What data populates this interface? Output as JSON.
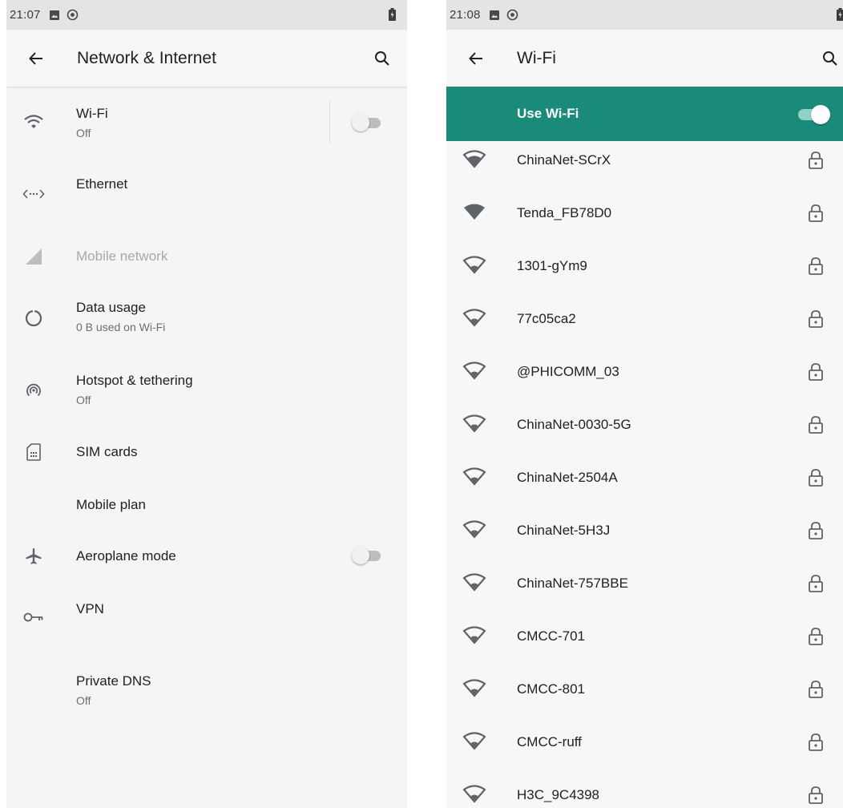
{
  "left": {
    "status": {
      "time": "21:07"
    },
    "title": "Network & Internet",
    "items": [
      {
        "title": "Wi-Fi",
        "subtitle": "Off",
        "icon": "wifi-icon"
      },
      {
        "title": "Ethernet",
        "subtitle": "",
        "icon": "ethernet-icon"
      },
      {
        "title": "Mobile network",
        "subtitle": "",
        "icon": "cellular-signal-icon"
      },
      {
        "title": "Data usage",
        "subtitle": "0 B used on Wi-Fi",
        "icon": "data-usage-icon"
      },
      {
        "title": "Hotspot & tethering",
        "subtitle": "Off",
        "icon": "hotspot-icon"
      },
      {
        "title": "SIM cards",
        "subtitle": "",
        "icon": "sim-card-icon"
      },
      {
        "title": "Mobile plan",
        "subtitle": ""
      },
      {
        "title": "Aeroplane mode",
        "subtitle": "",
        "icon": "airplane-icon"
      },
      {
        "title": "VPN",
        "subtitle": "",
        "icon": "vpn-key-icon"
      },
      {
        "title": "Private DNS",
        "subtitle": "Off"
      }
    ]
  },
  "right": {
    "status": {
      "time": "21:08"
    },
    "title": "Wi-Fi",
    "use_wifi_label": "Use Wi-Fi",
    "networks": [
      "ChinaNet-SCrX",
      "Tenda_FB78D0",
      "1301-gYm9",
      "77c05ca2",
      "@PHICOMM_03",
      "ChinaNet-0030-5G",
      "ChinaNet-2504A",
      "ChinaNet-5H3J",
      "ChinaNet-757BBE",
      "CMCC-701",
      "CMCC-801",
      "CMCC-ruff",
      "H3C_9C4398"
    ]
  },
  "colors": {
    "accent": "#1a8a7a",
    "screen_bg": "#f5f5f5",
    "status_bar": "#e4e4e4",
    "icon_gray": "#5f6368"
  }
}
